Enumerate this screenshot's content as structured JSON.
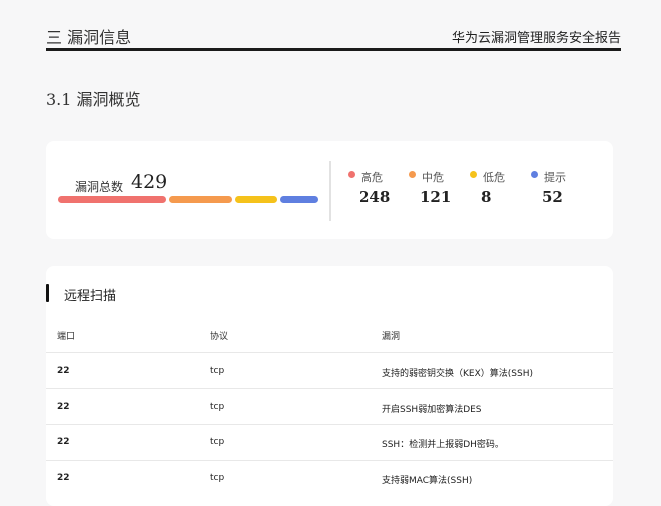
{
  "header": {
    "section_title": "三 漏洞信息",
    "report_title": "华为云漏洞管理服务安全报告"
  },
  "subsection_title": "3.1 漏洞概览",
  "summary": {
    "total_label": "漏洞总数",
    "total_value": "429",
    "levels": [
      {
        "label": "高危",
        "value": "248",
        "color": "#f0726e"
      },
      {
        "label": "中危",
        "value": "121",
        "color": "#f59a4e"
      },
      {
        "label": "低危",
        "value": "8",
        "color": "#f5c21b"
      },
      {
        "label": "提示",
        "value": "52",
        "color": "#5f7fe0"
      }
    ]
  },
  "remote_scan": {
    "title": "远程扫描",
    "columns": [
      "端口",
      "协议",
      "漏洞"
    ],
    "rows": [
      {
        "port": "22",
        "protocol": "tcp",
        "vuln": "支持的弱密钥交换（KEX）算法(SSH)"
      },
      {
        "port": "22",
        "protocol": "tcp",
        "vuln": "开启SSH弱加密算法DES"
      },
      {
        "port": "22",
        "protocol": "tcp",
        "vuln": "SSH：检测并上报弱DH密码。"
      },
      {
        "port": "22",
        "protocol": "tcp",
        "vuln": "支持弱MAC算法(SSH)"
      }
    ]
  }
}
